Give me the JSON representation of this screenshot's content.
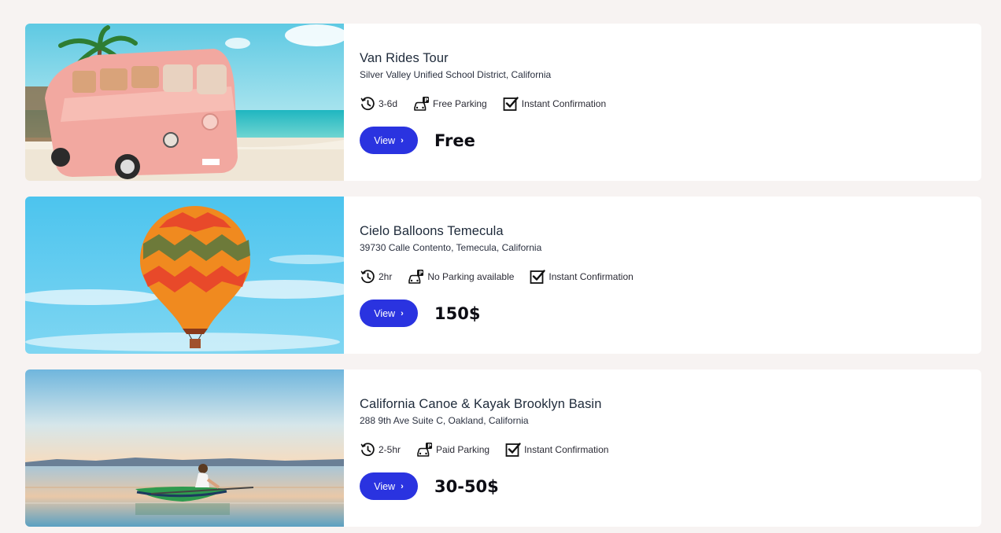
{
  "listings": [
    {
      "title": "Van Rides Tour",
      "address": "Silver Valley Unified School District, California",
      "duration": "3-6d",
      "parking": "Free Parking",
      "confirmation": "Instant Confirmation",
      "view_label": "View",
      "price": "Free",
      "image": "pink-van-on-beach"
    },
    {
      "title": "Cielo Balloons Temecula",
      "address": "39730 Calle Contento, Temecula, California",
      "duration": "2hr",
      "parking": "No Parking available",
      "confirmation": "Instant Confirmation",
      "view_label": "View",
      "price": "150$",
      "image": "hot-air-balloon-sky"
    },
    {
      "title": "California Canoe & Kayak Brooklyn Basin",
      "address": "288 9th Ave Suite C, Oakland, California",
      "duration": "2-5hr",
      "parking": "Paid Parking",
      "confirmation": "Instant Confirmation",
      "view_label": "View",
      "price": "30-50$",
      "image": "kayak-on-lake"
    }
  ],
  "icons": {
    "duration": "clock-icon",
    "parking": "car-parking-icon",
    "confirmation": "checkbox-icon",
    "view": "chevron-right-icon"
  },
  "colors": {
    "page_background": "#f7f3f2",
    "button": "#2a33e0",
    "card": "#ffffff"
  }
}
